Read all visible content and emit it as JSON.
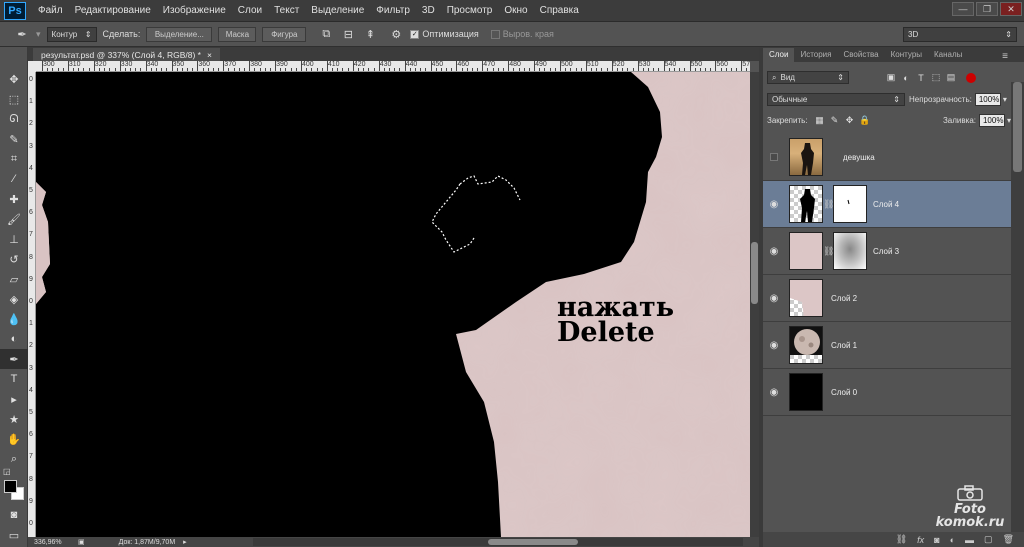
{
  "app": {
    "logo": "Ps"
  },
  "menu": [
    "Файл",
    "Редактирование",
    "Изображение",
    "Слои",
    "Текст",
    "Выделение",
    "Фильтр",
    "3D",
    "Просмотр",
    "Окно",
    "Справка"
  ],
  "options": {
    "mode": "Контур",
    "make_label": "Сделать:",
    "selection_btn": "Выделение...",
    "mask_btn": "Маска",
    "shape_btn": "Фигура",
    "optimize_label": "Оптимизация",
    "align_edges_label": "Выров. края",
    "workspace": "3D"
  },
  "document": {
    "tab_title": "результат.psd @ 337% (Слой 4, RGB/8) *",
    "close": "×"
  },
  "ruler": {
    "h_ticks": [
      "300",
      "310",
      "320",
      "330",
      "340",
      "350",
      "360",
      "370",
      "380",
      "390",
      "400",
      "410",
      "420",
      "430",
      "440",
      "450",
      "460",
      "470",
      "480",
      "490",
      "500",
      "510",
      "520",
      "530",
      "540",
      "550",
      "560",
      "570"
    ],
    "v_ticks": [
      "0",
      "1",
      "2",
      "3",
      "4",
      "5",
      "6",
      "7",
      "8",
      "9",
      "0",
      "1",
      "2",
      "3",
      "4",
      "5",
      "6",
      "7",
      "8",
      "9",
      "0"
    ]
  },
  "canvas": {
    "overlay_line1": "нажать",
    "overlay_line2": "Delete"
  },
  "status": {
    "zoom": "336,96%",
    "doc": "Док: 1,87M/9,70M"
  },
  "panel": {
    "tabs": [
      "Слои",
      "История",
      "Свойства",
      "Контуры",
      "Каналы"
    ],
    "kind_filter": "Вид",
    "blend_mode": "Обычные",
    "opacity_label": "Непрозрачность:",
    "opacity_value": "100%",
    "lock_label": "Закрепить:",
    "fill_label": "Заливка:",
    "fill_value": "100%"
  },
  "layers": [
    {
      "name": "девушка",
      "visible": false,
      "selected": false,
      "thumb": "photo",
      "mask": false
    },
    {
      "name": "Слой 4",
      "visible": true,
      "selected": true,
      "thumb": "silhouette",
      "mask": "white"
    },
    {
      "name": "Слой 3",
      "visible": true,
      "selected": false,
      "thumb": "pink",
      "mask": "gradient"
    },
    {
      "name": "Слой 2",
      "visible": true,
      "selected": false,
      "thumb": "pink-partial",
      "mask": false
    },
    {
      "name": "Слой 1",
      "visible": true,
      "selected": false,
      "thumb": "moon",
      "mask": false
    },
    {
      "name": "Слой 0",
      "visible": true,
      "selected": false,
      "thumb": "black",
      "mask": false
    }
  ],
  "footer_icons": [
    "link-icon",
    "fx-icon",
    "mask-icon",
    "adjustment-icon",
    "folder-icon",
    "new-layer-icon",
    "trash-icon"
  ],
  "watermark": {
    "line1": "Foto",
    "line2": "komok.ru"
  },
  "colors": {
    "selected_layer": "#6b7d96",
    "canvas_pink": "#d8c2c2",
    "ps_blue": "#31a8ff"
  }
}
